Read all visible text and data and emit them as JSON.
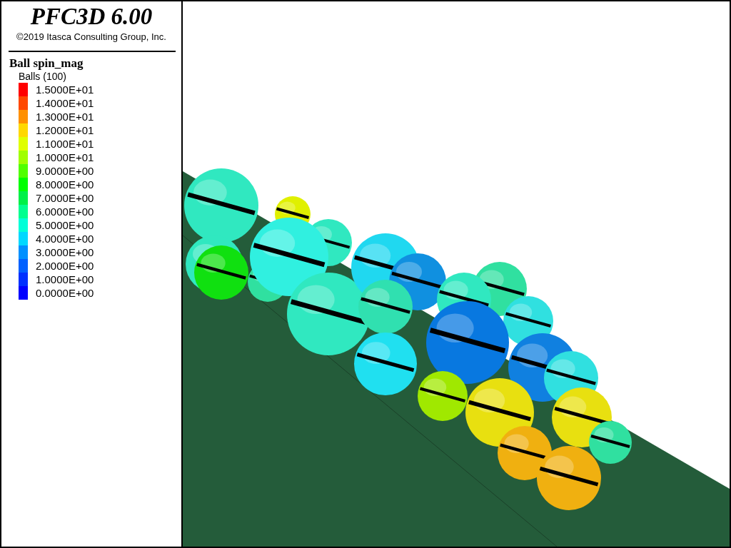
{
  "legend": {
    "title": "PFC3D 6.00",
    "copyright": "©2019 Itasca Consulting Group, Inc.",
    "plot_title": "Ball spin_mag",
    "group_label": "Balls (100)",
    "items": [
      {
        "label": "1.5000E+01",
        "color": "#ff0000"
      },
      {
        "label": "1.4000E+01",
        "color": "#ff4800"
      },
      {
        "label": "1.3000E+01",
        "color": "#ff9000"
      },
      {
        "label": "1.2000E+01",
        "color": "#ffd800"
      },
      {
        "label": "1.1000E+01",
        "color": "#e0ff00"
      },
      {
        "label": "1.0000E+01",
        "color": "#a0ff00"
      },
      {
        "label": "9.0000E+00",
        "color": "#50ff00"
      },
      {
        "label": "8.0000E+00",
        "color": "#00ff00"
      },
      {
        "label": "7.0000E+00",
        "color": "#00f048"
      },
      {
        "label": "6.0000E+00",
        "color": "#00ff90"
      },
      {
        "label": "5.0000E+00",
        "color": "#00ffd8"
      },
      {
        "label": "4.0000E+00",
        "color": "#00d8ff"
      },
      {
        "label": "3.0000E+00",
        "color": "#0090ff"
      },
      {
        "label": "2.0000E+00",
        "color": "#0060ff"
      },
      {
        "label": "1.0000E+00",
        "color": "#0030ff"
      },
      {
        "label": "0.0000E+00",
        "color": "#0000ff"
      }
    ]
  }
}
